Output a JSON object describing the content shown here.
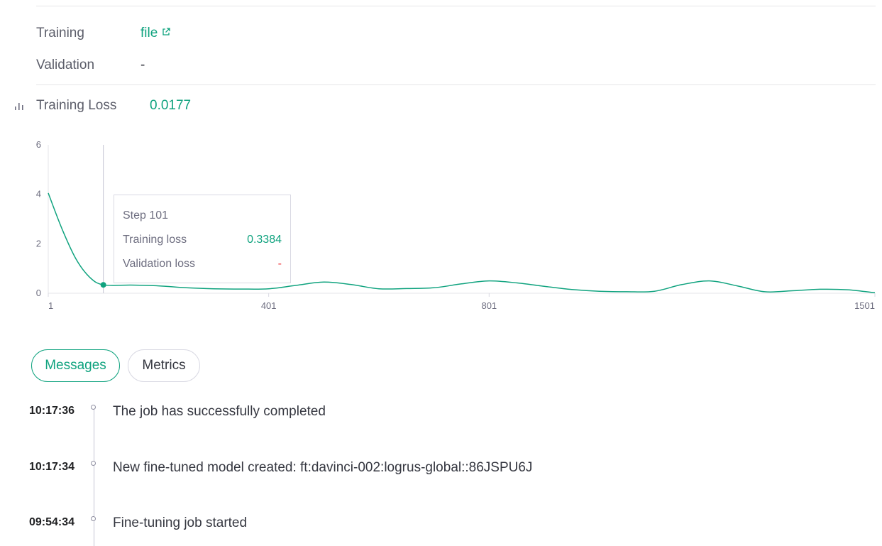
{
  "details": {
    "training_label": "Training",
    "training_value": "file",
    "validation_label": "Validation",
    "validation_value": "-"
  },
  "metric": {
    "label": "Training Loss",
    "value": "0.0177"
  },
  "tooltip": {
    "step": "Step 101",
    "training_label": "Training loss",
    "training_value": "0.3384",
    "validation_label": "Validation loss",
    "validation_value": "-"
  },
  "chart_data": {
    "type": "line",
    "title": "",
    "xlabel": "",
    "ylabel": "",
    "xlim": [
      1,
      1501
    ],
    "ylim": [
      0,
      6
    ],
    "x_ticks": [
      1,
      401,
      801,
      1501
    ],
    "y_ticks": [
      0,
      2,
      4,
      6
    ],
    "grid": false,
    "line_color": "#10a37f",
    "highlight": {
      "x": 101,
      "y": 0.3384
    },
    "series": [
      {
        "x": [
          1,
          26,
          51,
          76,
          101,
          151,
          201,
          251,
          301,
          351,
          401,
          451,
          501,
          551,
          601,
          651,
          701,
          751,
          801,
          851,
          901,
          951,
          1001,
          1051,
          1101,
          1151,
          1201,
          1251,
          1301,
          1351,
          1401,
          1451,
          1501
        ],
        "y": [
          4.05,
          2.6,
          1.4,
          0.65,
          0.34,
          0.33,
          0.3,
          0.22,
          0.18,
          0.17,
          0.18,
          0.32,
          0.45,
          0.35,
          0.18,
          0.19,
          0.22,
          0.38,
          0.5,
          0.42,
          0.28,
          0.15,
          0.08,
          0.06,
          0.08,
          0.35,
          0.5,
          0.3,
          0.06,
          0.1,
          0.16,
          0.14,
          0.02
        ]
      }
    ]
  },
  "tabs": {
    "messages": "Messages",
    "metrics": "Metrics"
  },
  "messages": [
    {
      "time": "10:17:36",
      "text": "The job has successfully completed"
    },
    {
      "time": "10:17:34",
      "text": "New fine-tuned model created: ft:davinci-002:logrus-global::86JSPU6J"
    },
    {
      "time": "09:54:34",
      "text": "Fine-tuning job started"
    }
  ]
}
